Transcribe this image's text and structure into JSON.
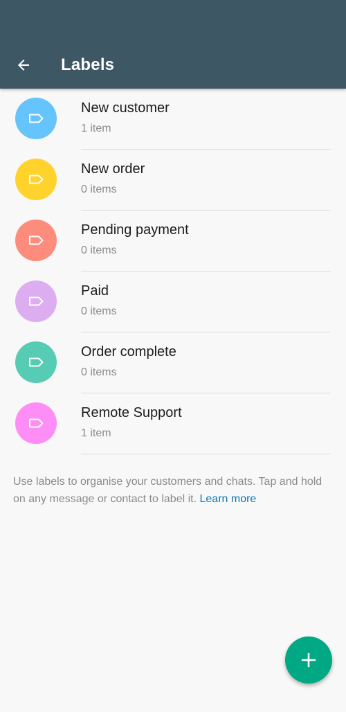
{
  "header": {
    "title": "Labels",
    "back_icon": "arrow-left-icon",
    "background": "#3d5764"
  },
  "labels": [
    {
      "name": "New customer",
      "count": "1 item",
      "color": "#64c4fb",
      "icon": "label-tag-icon"
    },
    {
      "name": "New order",
      "count": "0 items",
      "color": "#ffd32c",
      "icon": "label-tag-icon"
    },
    {
      "name": "Pending payment",
      "count": "0 items",
      "color": "#fe8c7c",
      "icon": "label-tag-icon"
    },
    {
      "name": "Paid",
      "count": "0 items",
      "color": "#dcadf0",
      "icon": "label-tag-icon"
    },
    {
      "name": "Order complete",
      "count": "0 items",
      "color": "#55ccb3",
      "icon": "label-tag-icon"
    },
    {
      "name": "Remote Support",
      "count": "1 item",
      "color": "#ff8df6",
      "icon": "label-tag-icon"
    }
  ],
  "footer": {
    "text": "Use labels to organise your customers and chats. Tap and hold on any message or contact to label it.",
    "link": "Learn more",
    "link_color": "#0a78b5"
  },
  "fab": {
    "icon": "plus-icon",
    "color": "#00a884"
  }
}
